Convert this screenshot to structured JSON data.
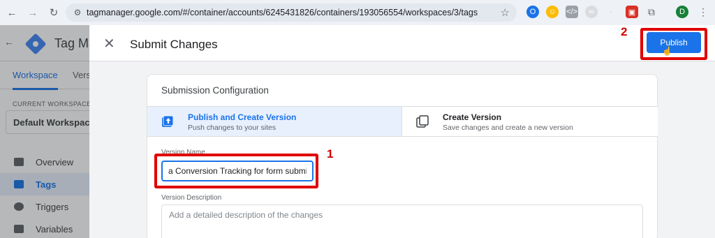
{
  "browser": {
    "url": "tagmanager.google.com/#/container/accounts/6245431826/containers/193056554/workspaces/3/tags",
    "profile_initial": "D"
  },
  "app": {
    "title": "Tag Ma",
    "tabs": [
      "Workspace",
      "Vers"
    ],
    "current_workspace_label": "CURRENT WORKSPACE",
    "current_workspace": "Default Workspace",
    "sidebar": [
      {
        "label": "Overview",
        "active": false
      },
      {
        "label": "Tags",
        "active": true
      },
      {
        "label": "Triggers",
        "active": false
      },
      {
        "label": "Variables",
        "active": false
      }
    ]
  },
  "panel": {
    "title": "Submit Changes",
    "publish_label": "Publish",
    "config_title": "Submission Configuration",
    "options": [
      {
        "title": "Publish and Create Version",
        "subtitle": "Push changes to your sites",
        "selected": true
      },
      {
        "title": "Create Version",
        "subtitle": "Save changes and create a new version",
        "selected": false
      }
    ],
    "version_name_label": "Version Name",
    "version_name_value": "a Conversion Tracking for form submits",
    "version_description_label": "Version Description",
    "version_description_placeholder": "Add a detailed description of the changes"
  },
  "annotations": {
    "step_1": "1",
    "step_2": "2",
    "highlight_color": "#e00000"
  },
  "colors": {
    "accent": "#1a73e8",
    "brand": "#4285f4"
  }
}
